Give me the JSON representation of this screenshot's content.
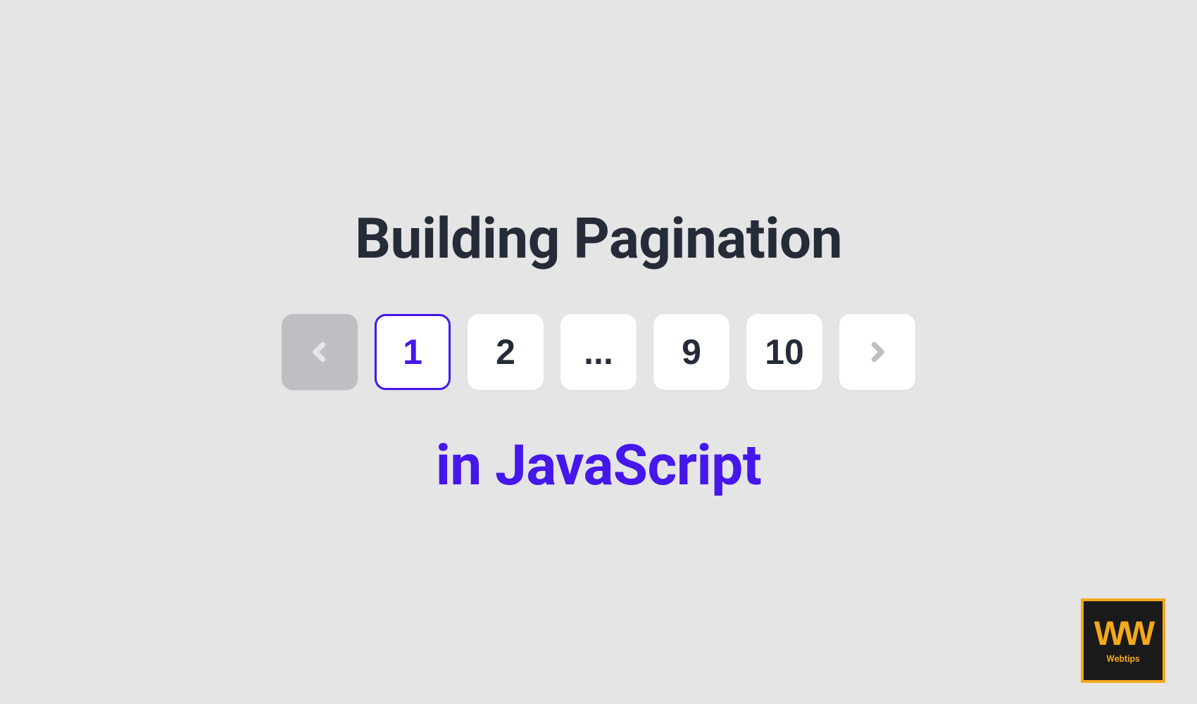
{
  "title": "Building Pagination",
  "subtitle": "in JavaScript",
  "pagination": {
    "pages": [
      "1",
      "2",
      "...",
      "9",
      "10"
    ],
    "active_index": 0,
    "ellipsis_index": 2,
    "prev_disabled": true,
    "next_disabled": false
  },
  "logo": {
    "main": "WW",
    "sub": "Webtips"
  },
  "colors": {
    "bg": "#e5e5e6",
    "text_dark": "#252b37",
    "accent": "#4517ea",
    "disabled": "#bdbfc3",
    "logo_border": "#f4a81b",
    "logo_bg": "#1a1a1a"
  }
}
